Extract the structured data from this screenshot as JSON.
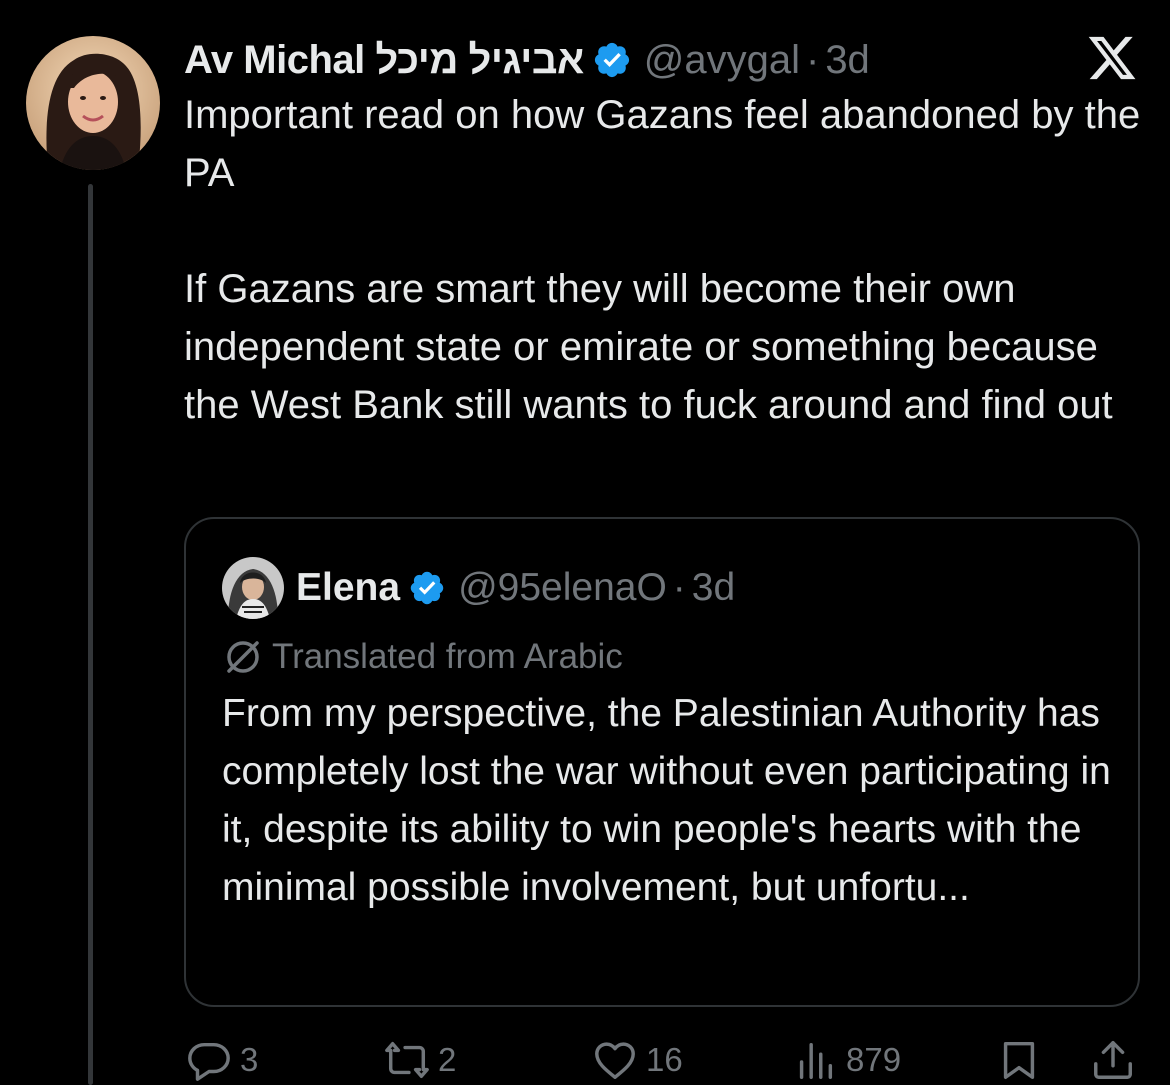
{
  "tweet": {
    "display_name": "Av Michal אביגיל מיכל",
    "handle": "@avygal",
    "separator": "·",
    "time": "3d",
    "text": "Important read on how Gazans feel abandoned by the PA\n\nIf Gazans are smart they will become their own independent state or emirate or something because the West Bank still wants to fuck around and find out",
    "avatar_icon": "profile-photo-woman",
    "verified_color": "#1d9bf0"
  },
  "quote": {
    "display_name": "Elena",
    "handle": "@95elenaO",
    "separator": "·",
    "time": "3d",
    "translated_label": "Translated from Arabic",
    "text": "From my perspective, the Palestinian Authority has completely lost the war without even participating in it, despite its ability to win people's hearts with the minimal possible involvement, but unfortu..."
  },
  "actions": {
    "replies": "3",
    "reposts": "2",
    "likes": "16",
    "views": "879"
  },
  "colors": {
    "background": "#000000",
    "text": "#e7e9ea",
    "muted": "#71767b",
    "border": "#2f3336",
    "accent": "#1d9bf0"
  }
}
